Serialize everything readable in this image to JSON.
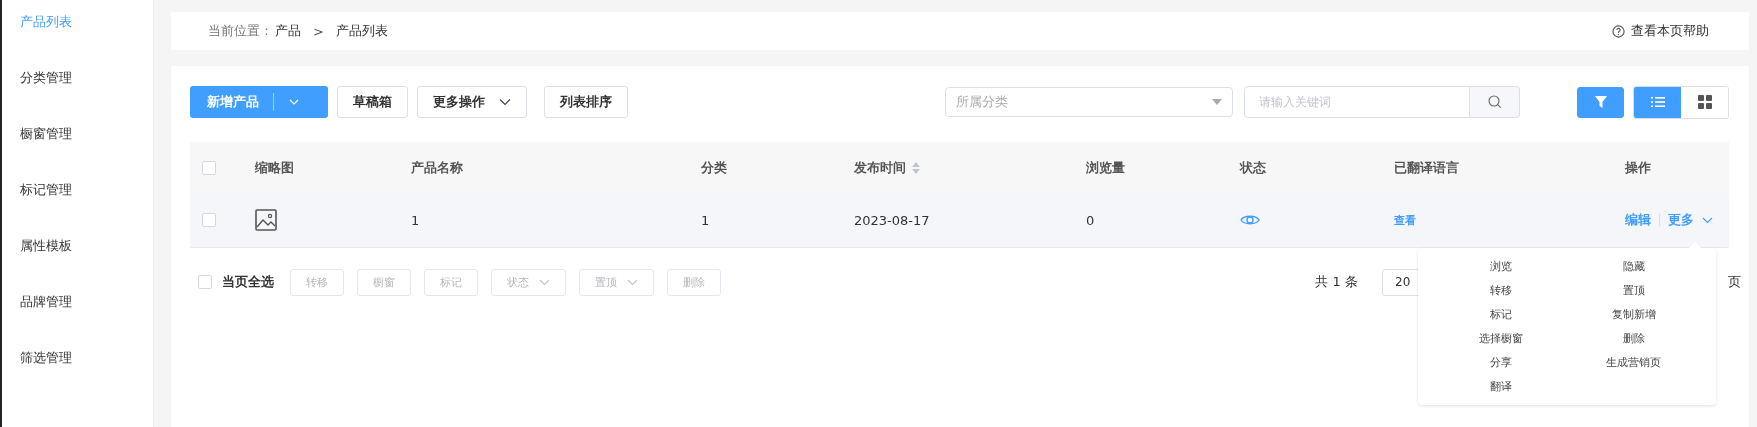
{
  "sidebar": {
    "items": [
      {
        "label": "产品列表",
        "selected": true
      },
      {
        "label": "分类管理",
        "selected": false
      },
      {
        "label": "橱窗管理",
        "selected": false
      },
      {
        "label": "标记管理",
        "selected": false
      },
      {
        "label": "属性模板",
        "selected": false
      },
      {
        "label": "品牌管理",
        "selected": false
      },
      {
        "label": "筛选管理",
        "selected": false
      }
    ]
  },
  "breadcrumb": {
    "prefix": "当前位置：",
    "items": [
      "产品",
      "产品列表"
    ],
    "separator": ">",
    "help": "查看本页帮助"
  },
  "toolbar": {
    "buttons": [
      {
        "label": "新增产品",
        "kind": "split"
      },
      {
        "label": "草稿箱",
        "kind": "plain"
      },
      {
        "label": "更多操作",
        "kind": "dropdown"
      },
      {
        "label": "列表排序",
        "kind": "plain"
      }
    ],
    "category_select": {
      "placeholder": "所属分类"
    },
    "search": {
      "placeholder": "请输入关键词"
    },
    "filter": {
      "on": true
    },
    "view_modes": [
      {
        "kind": "list",
        "selected": true
      },
      {
        "kind": "grid",
        "selected": false
      }
    ]
  },
  "table": {
    "columns": [
      {
        "label": "缩略图",
        "sortable": false
      },
      {
        "label": "产品名称",
        "sortable": false
      },
      {
        "label": "分类",
        "sortable": false
      },
      {
        "label": "发布时间",
        "sortable": true
      },
      {
        "label": "浏览量",
        "sortable": false
      },
      {
        "label": "状态",
        "sortable": false
      },
      {
        "label": "已翻译语言",
        "sortable": false
      },
      {
        "label": "操作",
        "sortable": false
      }
    ],
    "all_checked": false,
    "rows": [
      {
        "checked": false,
        "name": "1",
        "category": "1",
        "date": "2023-08-17",
        "views": "0",
        "visible": true,
        "translations": "查看",
        "edit": "编辑",
        "more": "更多"
      }
    ]
  },
  "bulk": {
    "select_all": {
      "label": "当页全选",
      "checked": false
    },
    "buttons": [
      {
        "label": "转移",
        "kind": "plain",
        "disabled": true
      },
      {
        "label": "橱窗",
        "kind": "plain",
        "disabled": true
      },
      {
        "label": "标记",
        "kind": "plain",
        "disabled": true
      },
      {
        "label": "状态",
        "kind": "dropdown",
        "disabled": true
      },
      {
        "label": "置顶",
        "kind": "dropdown",
        "disabled": true
      },
      {
        "label": "删除",
        "kind": "plain",
        "disabled": true
      }
    ]
  },
  "pagination": {
    "total": "共 1 条",
    "page_size": "20",
    "tail": "页"
  },
  "more_menu": {
    "items": [
      "浏览",
      "隐藏",
      "转移",
      "置顶",
      "标记",
      "复制新增",
      "选择橱窗",
      "删除",
      "分享",
      "生成营销页",
      "翻译"
    ]
  }
}
